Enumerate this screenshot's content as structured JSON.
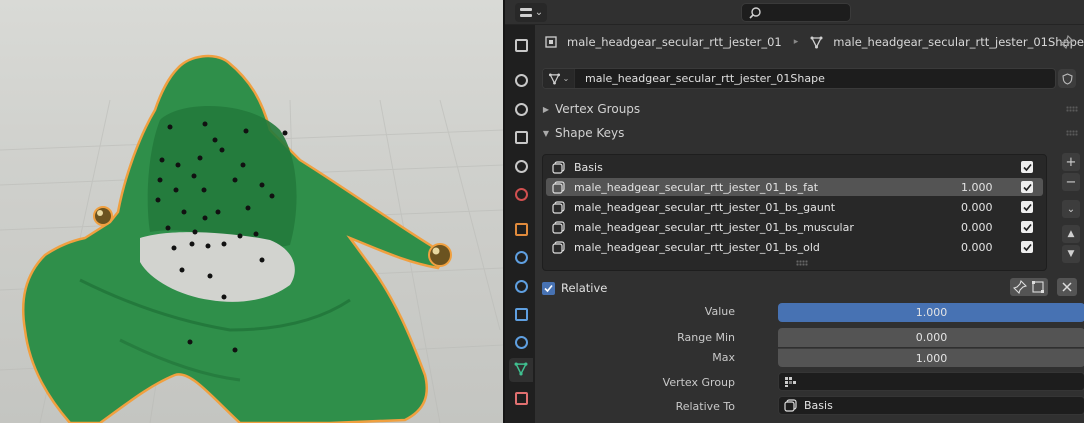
{
  "viewport": {
    "object": "jester hood mesh",
    "outline_color": "#f0a040",
    "mesh_color": "#2f8f4a"
  },
  "header": {
    "editor_type_icon": "properties-editor-icon",
    "search_icon": "search-icon"
  },
  "tabs": [
    {
      "name": "tool-tab",
      "icon": "tool-icon",
      "color": "#c8c8c8"
    },
    {
      "name": "render-tab",
      "icon": "render-icon",
      "color": "#c8c8c8"
    },
    {
      "name": "output-tab",
      "icon": "output-icon",
      "color": "#c8c8c8"
    },
    {
      "name": "view-layer-tab",
      "icon": "view-layer-icon",
      "color": "#c8c8c8"
    },
    {
      "name": "scene-tab",
      "icon": "scene-icon",
      "color": "#c8c8c8"
    },
    {
      "name": "world-tab",
      "icon": "world-icon",
      "color": "#d05050"
    },
    {
      "name": "object-tab",
      "icon": "object-icon",
      "color": "#e08a3c"
    },
    {
      "name": "modifiers-tab",
      "icon": "wrench-icon",
      "color": "#5f9fe0"
    },
    {
      "name": "particles-tab",
      "icon": "particles-icon",
      "color": "#5f9fe0"
    },
    {
      "name": "physics-tab",
      "icon": "physics-icon",
      "color": "#5f9fe0"
    },
    {
      "name": "constraints-tab",
      "icon": "constraints-icon",
      "color": "#5f9fe0"
    },
    {
      "name": "data-tab",
      "icon": "mesh-data-icon",
      "color": "#40c090"
    },
    {
      "name": "material-tab",
      "icon": "material-icon",
      "color": "#e07070"
    }
  ],
  "breadcrumb": {
    "object": "male_headgear_secular_rtt_jester_01",
    "mesh": "male_headgear_secular_rtt_jester_01Shape"
  },
  "datablock": {
    "name": "male_headgear_secular_rtt_jester_01Shape"
  },
  "panels": {
    "vertex_groups": "Vertex Groups",
    "shape_keys": "Shape Keys"
  },
  "shape_keys": [
    {
      "name": "Basis",
      "value": "",
      "checked": true,
      "selected": false
    },
    {
      "name": "male_headgear_secular_rtt_jester_01_bs_fat",
      "value": "1.000",
      "checked": true,
      "selected": true
    },
    {
      "name": "male_headgear_secular_rtt_jester_01_bs_gaunt",
      "value": "0.000",
      "checked": true,
      "selected": false
    },
    {
      "name": "male_headgear_secular_rtt_jester_01_bs_muscular",
      "value": "0.000",
      "checked": true,
      "selected": false
    },
    {
      "name": "male_headgear_secular_rtt_jester_01_bs_old",
      "value": "0.000",
      "checked": true,
      "selected": false
    }
  ],
  "list_buttons": {
    "add": "+",
    "remove": "−"
  },
  "relative": {
    "label": "Relative",
    "checked": true
  },
  "fields": {
    "value_label": "Value",
    "value": "1.000",
    "value_fraction": 1.0,
    "range_min_label": "Range Min",
    "range_min": "0.000",
    "max_label": "Max",
    "max": "1.000",
    "vertex_group_label": "Vertex Group",
    "vertex_group": "",
    "relative_to_label": "Relative To",
    "relative_to": "Basis"
  },
  "colors": {
    "accent": "#4772b3",
    "selected_row": "#545454"
  }
}
